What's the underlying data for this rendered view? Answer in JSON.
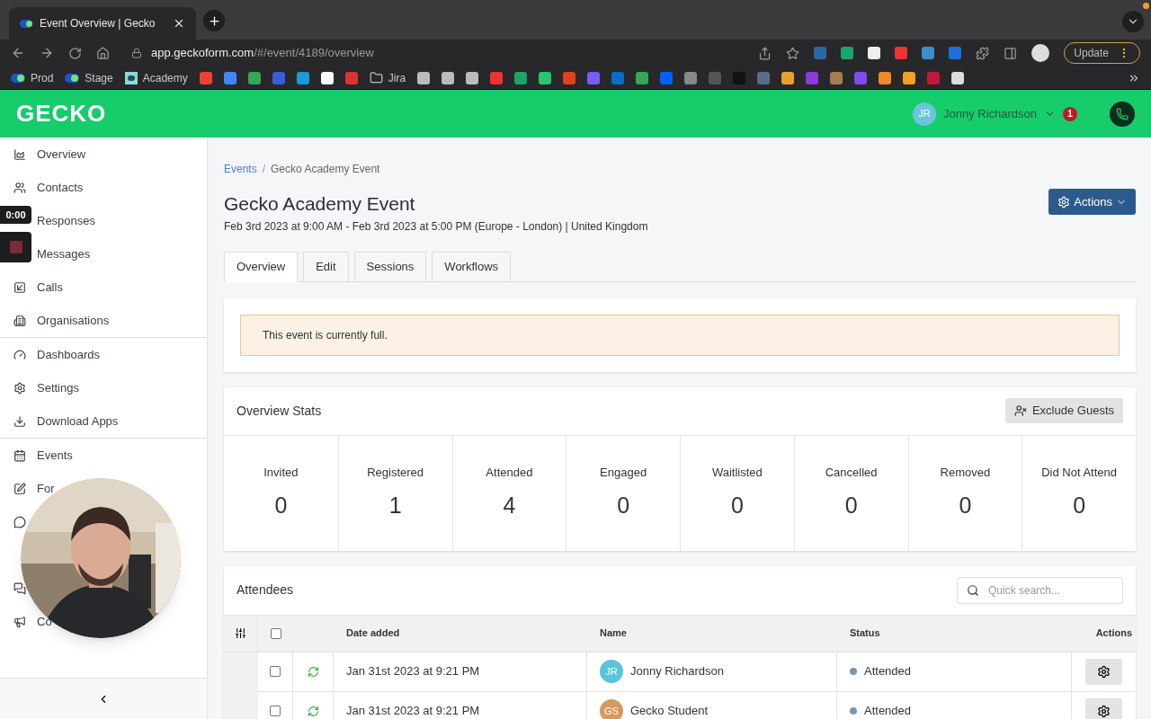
{
  "browser": {
    "tab_title": "Event Overview | Gecko",
    "url_host": "app.geckoform.com",
    "url_path": "/#/event/4189/overview",
    "update_button": "Update",
    "bookmarks": [
      {
        "label": "Prod",
        "kind": "dot"
      },
      {
        "label": "Stage",
        "kind": "dot"
      },
      {
        "label": "Academy",
        "kind": "site"
      },
      {
        "label": "Jira",
        "kind": "folder"
      }
    ]
  },
  "header": {
    "logo": "GECKO",
    "user_initials": "JR",
    "user_name": "Jonny Richardson",
    "notifications": "1"
  },
  "sidebar": {
    "sections": [
      [
        {
          "label": "Overview",
          "kind": "item"
        },
        {
          "label": "Contacts",
          "kind": "item"
        },
        {
          "label": "Responses",
          "kind": "label_only"
        },
        {
          "label": "Messages",
          "kind": "label_only"
        },
        {
          "label": "Calls",
          "kind": "item"
        },
        {
          "label": "Organisations",
          "kind": "item"
        }
      ],
      [
        {
          "label": "Dashboards",
          "kind": "item"
        },
        {
          "label": "Settings",
          "kind": "item"
        },
        {
          "label": "Download Apps",
          "kind": "item"
        }
      ],
      [
        {
          "label": "Events",
          "kind": "item"
        },
        {
          "label": "For",
          "kind": "item"
        },
        {
          "kind": "icon_only"
        },
        {
          "kind": "covered"
        },
        {
          "kind": "icon_only"
        },
        {
          "label": "Co",
          "kind": "item"
        }
      ]
    ]
  },
  "recorder": {
    "time": "0:00"
  },
  "breadcrumb": {
    "separator": "/",
    "items": [
      {
        "label": "Events",
        "kind": "link"
      },
      {
        "label": "Gecko Academy Event",
        "kind": "current"
      }
    ]
  },
  "event": {
    "title": "Gecko Academy Event",
    "subtitle": "Feb 3rd 2023 at 9:00 AM - Feb 3rd 2023 at 5:00 PM (Europe - London) | United Kingdom",
    "actions_button": "Actions"
  },
  "tabs": [
    {
      "label": "Overview",
      "selected": true
    },
    {
      "label": "Edit",
      "selected": false
    },
    {
      "label": "Sessions",
      "selected": false
    },
    {
      "label": "Workflows",
      "selected": false
    }
  ],
  "alert": "This event is currently full.",
  "stats": {
    "title": "Overview Stats",
    "button": "Exclude Guests",
    "items": [
      {
        "label": "Invited",
        "value": "0"
      },
      {
        "label": "Registered",
        "value": "1"
      },
      {
        "label": "Attended",
        "value": "4"
      },
      {
        "label": "Engaged",
        "value": "0"
      },
      {
        "label": "Waitlisted",
        "value": "0"
      },
      {
        "label": "Cancelled",
        "value": "0"
      },
      {
        "label": "Removed",
        "value": "0"
      },
      {
        "label": "Did Not Attend",
        "value": "0"
      }
    ]
  },
  "attendees": {
    "title": "Attendees",
    "search_placeholder": "Quick search...",
    "select_all_checked": false,
    "columns": [
      "Date added",
      "Name",
      "Status",
      "Actions"
    ],
    "rows": [
      {
        "checked": false,
        "date": "Jan 31st 2023 at 9:21 PM",
        "initials": "JR",
        "color": "#5cc3dc",
        "name": "Jonny Richardson",
        "status": "Attended"
      },
      {
        "checked": false,
        "date": "Jan 31st 2023 at 9:21 PM",
        "initials": "GS",
        "color": "#d49a5e",
        "name": "Gecko Student",
        "status": "Attended"
      }
    ]
  }
}
